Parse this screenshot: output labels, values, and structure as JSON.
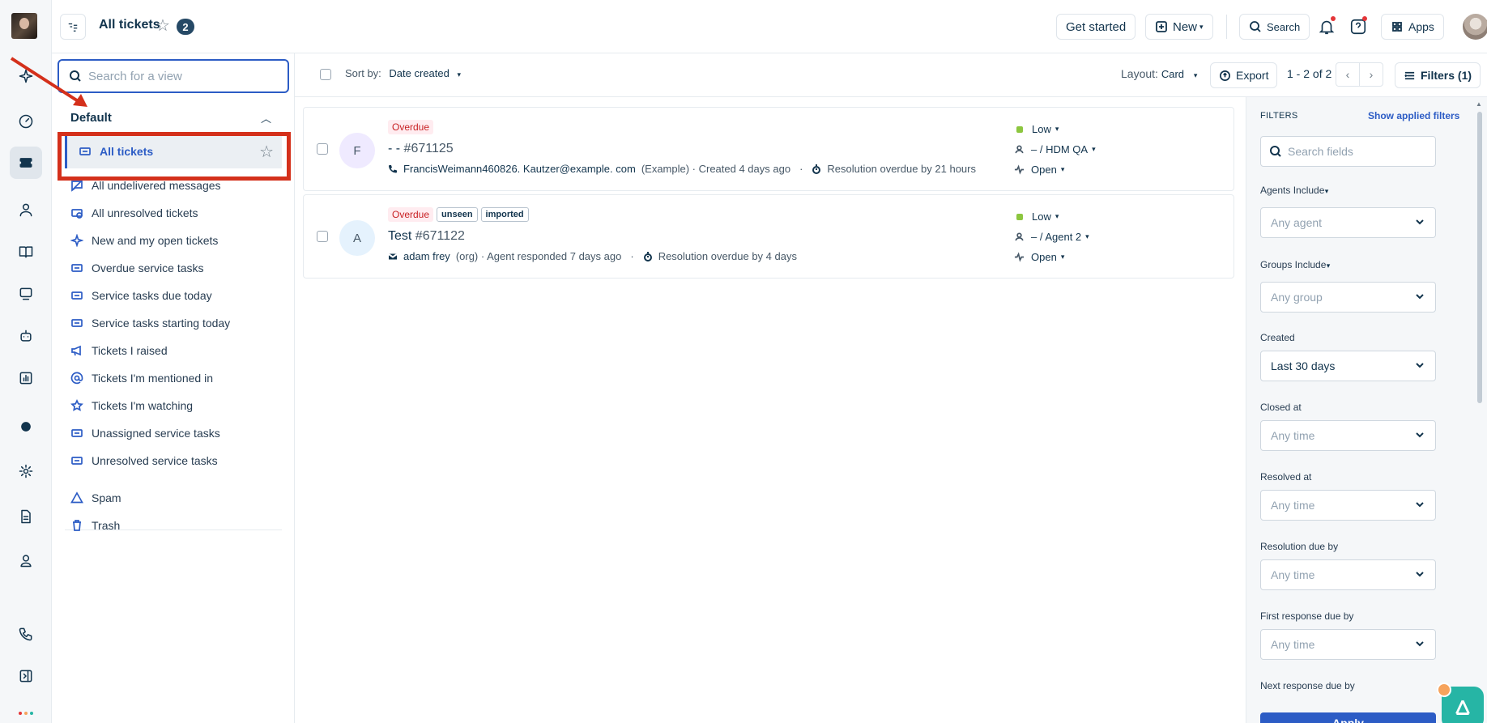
{
  "topbar": {
    "title": "All tickets",
    "count": "2",
    "get_started": "Get started",
    "new_label": "New",
    "search_label": "Search",
    "apps_label": "Apps"
  },
  "views": {
    "search_placeholder": "Search for a view",
    "group": "Default",
    "items": [
      {
        "label": "All tickets",
        "icon": "ticket-icon"
      },
      {
        "label": "All undelivered messages",
        "icon": "message-off-icon"
      },
      {
        "label": "All unresolved tickets",
        "icon": "ticket-clock-icon"
      },
      {
        "label": "New and my open tickets",
        "icon": "sparkle-icon"
      },
      {
        "label": "Overdue service tasks",
        "icon": "ticket-icon"
      },
      {
        "label": "Service tasks due today",
        "icon": "ticket-icon"
      },
      {
        "label": "Service tasks starting today",
        "icon": "ticket-icon"
      },
      {
        "label": "Tickets I raised",
        "icon": "megaphone-icon"
      },
      {
        "label": "Tickets I'm mentioned in",
        "icon": "at-icon"
      },
      {
        "label": "Tickets I'm watching",
        "icon": "star-icon"
      },
      {
        "label": "Unassigned service tasks",
        "icon": "ticket-icon"
      },
      {
        "label": "Unresolved service tasks",
        "icon": "ticket-icon"
      }
    ],
    "extra": [
      {
        "label": "Spam",
        "icon": "warning-icon"
      },
      {
        "label": "Trash",
        "icon": "trash-icon"
      }
    ]
  },
  "toolbar": {
    "sort_by_label": "Sort by:",
    "sort_by_value": "Date created",
    "layout_label": "Layout:",
    "layout_value": "Card",
    "export_label": "Export",
    "pager": "1 - 2 of 2",
    "filters_label": "Filters (1)"
  },
  "tickets": [
    {
      "avatar": "F",
      "avatar_bg": "#efeaff",
      "tags": [
        "Overdue"
      ],
      "subject": "- - ",
      "number": "#671125",
      "requester": "FrancisWeimann460826. Kautzer@example. com",
      "requester_suffix": "(Example) · Created 4 days ago",
      "sla": "Resolution overdue by 21 hours",
      "priority": "Low",
      "assignee": "– / HDM QA",
      "status": "Open"
    },
    {
      "avatar": "A",
      "avatar_bg": "#e5f2fd",
      "tags": [
        "Overdue",
        "unseen",
        "imported"
      ],
      "subject": "Test ",
      "number": "#671122",
      "requester": "adam frey",
      "requester_suffix": "(org) · Agent responded 7 days ago",
      "sla": "Resolution overdue by 4 days",
      "priority": "Low",
      "assignee": "– / Agent 2",
      "status": "Open"
    }
  ],
  "filters": {
    "title": "FILTERS",
    "show_applied": "Show applied filters",
    "search_placeholder": "Search fields",
    "fields": [
      {
        "label": "Agents Include",
        "value": "Any agent",
        "selected": false,
        "has_caret": true
      },
      {
        "label": "Groups Include",
        "value": "Any group",
        "selected": false,
        "has_caret": true
      },
      {
        "label": "Created",
        "value": "Last 30 days",
        "selected": true,
        "has_caret": false
      },
      {
        "label": "Closed at",
        "value": "Any time",
        "selected": false,
        "has_caret": false
      },
      {
        "label": "Resolved at",
        "value": "Any time",
        "selected": false,
        "has_caret": false
      },
      {
        "label": "Resolution due by",
        "value": "Any time",
        "selected": false,
        "has_caret": false
      },
      {
        "label": "First response due by",
        "value": "Any time",
        "selected": false,
        "has_caret": false
      }
    ],
    "next_label": "Next response due by",
    "apply_label": "Apply"
  },
  "colors": {
    "accent": "#2c5cc5",
    "highlight": "#d4301b",
    "overdue_bg": "#ffecf0",
    "overdue_text": "#c82124",
    "priority_low": "#8cc63f"
  }
}
